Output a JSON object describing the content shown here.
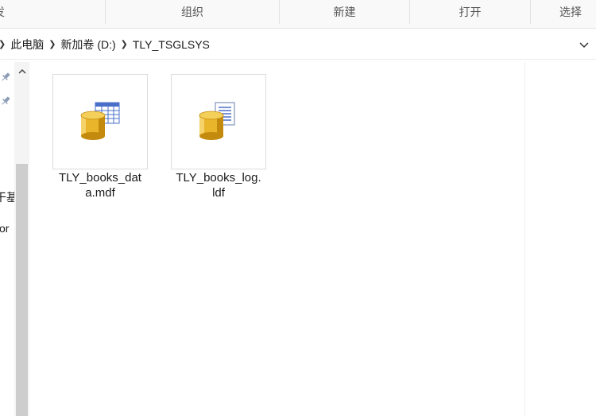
{
  "ribbon": {
    "groups": [
      "发",
      "组织",
      "新建",
      "打开",
      "选择"
    ]
  },
  "address": {
    "path": [
      "此电脑",
      "新加卷 (D:)",
      "TLY_TSGLSYS"
    ]
  },
  "nav": {
    "clipped_items": [
      "干基",
      "or"
    ]
  },
  "files": [
    {
      "name_line1": "TLY_books_dat",
      "name_line2": "a.mdf",
      "icon": "sql-data-file-icon"
    },
    {
      "name_line1": "TLY_books_log.",
      "name_line2": "ldf",
      "icon": "sql-log-file-icon"
    }
  ],
  "colors": {
    "cylinder": "#e9b52a",
    "cylinder_dark": "#c48a0e",
    "grid_blue": "#4a6fc9",
    "scroll_thumb": "#cdcdcd"
  }
}
